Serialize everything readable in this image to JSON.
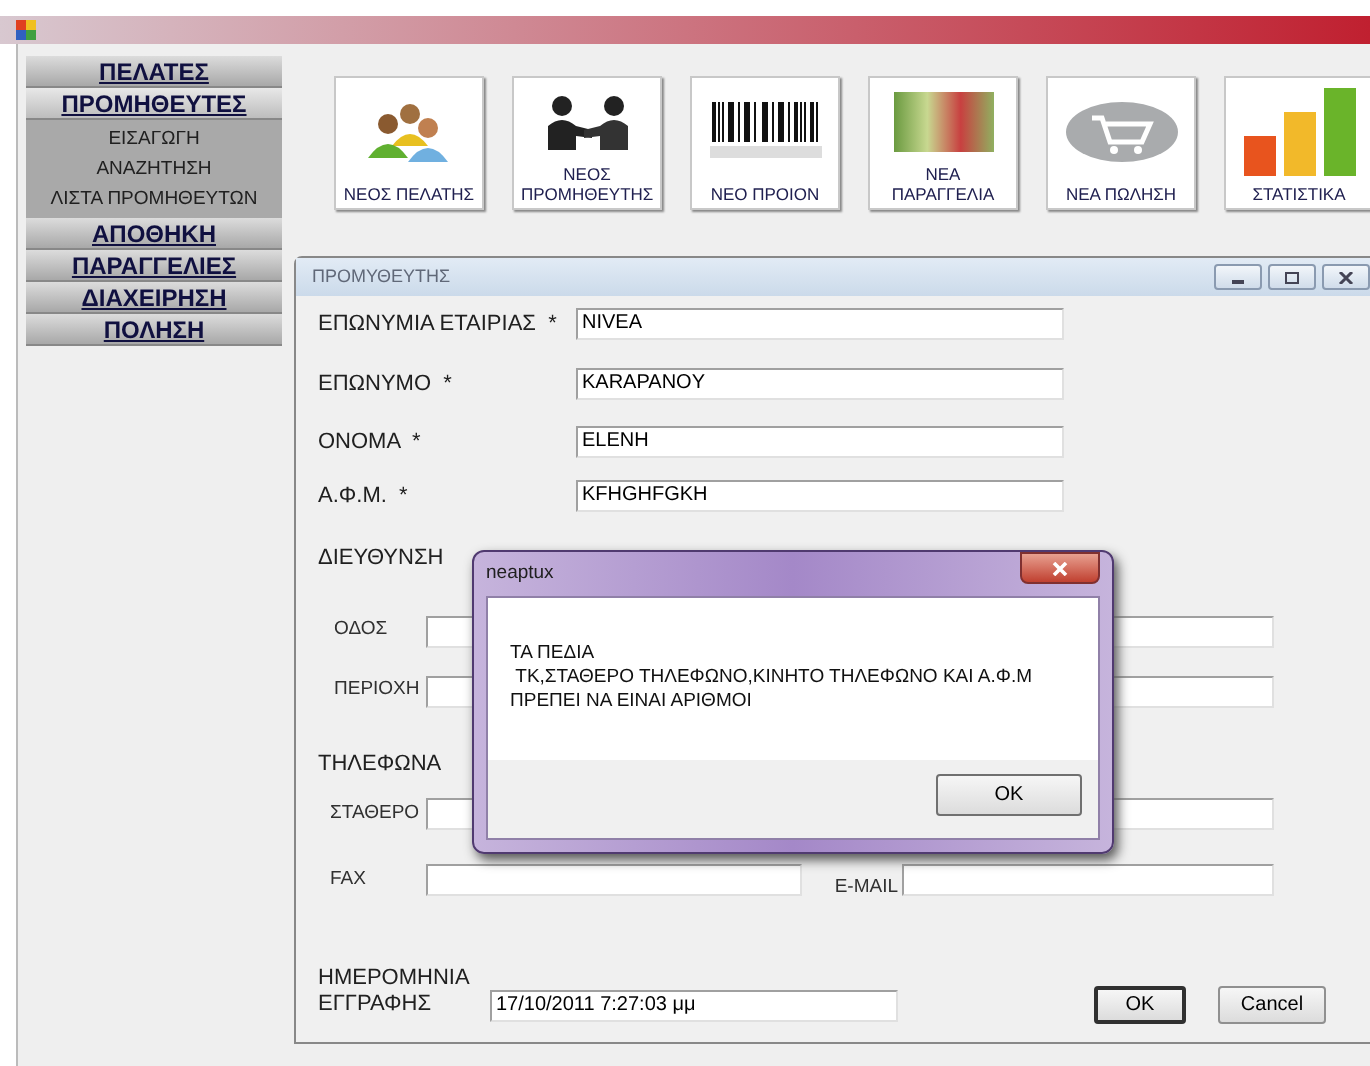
{
  "menu": [
    {
      "label": "ΠΕΛΑΤΕΣ",
      "expanded": false
    },
    {
      "label": "ΠΡΟΜΗΘΕΥΤΕΣ",
      "expanded": true,
      "children": [
        {
          "label": "ΕΙΣΑΓΩΓΗ"
        },
        {
          "label": "ΑΝΑΖΗΤΗΣΗ"
        },
        {
          "label": "ΛΙΣΤΑ ΠΡΟΜΗΘΕΥΤΩΝ"
        }
      ]
    },
    {
      "label": "ΑΠΟΘΗΚΗ",
      "expanded": false
    },
    {
      "label": "ΠΑΡΑΓΓΕΛΙΕΣ",
      "expanded": false
    },
    {
      "label": "ΔΙΑΧΕΙΡΗΣΗ",
      "expanded": false
    },
    {
      "label": "ΠΟΛΗΣΗ",
      "expanded": false
    }
  ],
  "toolbar": [
    {
      "label": "ΝΕΟΣ ΠΕΛΑΤΗΣ",
      "kind": "people"
    },
    {
      "label": "ΝΕΟΣ ΠΡΟΜΗΘΕΥΤΗΣ",
      "kind": "handshake"
    },
    {
      "label": "ΝΕΟ ΠΡΟΙΟΝ",
      "kind": "barcode"
    },
    {
      "label": "ΝΕΑ ΠΑΡΑΓΓΕΛΙΑ",
      "kind": "produce"
    },
    {
      "label": "ΝΕΑ ΠΩΛΗΣΗ",
      "kind": "cart"
    },
    {
      "label": "ΣΤΑΤΙΣΤΙΚΑ",
      "kind": "chart"
    }
  ],
  "form": {
    "title": "ΠΡΟΜΥΘΕΥΤΗΣ",
    "required_fields": [
      {
        "label": "ΕΠΩΝΥΜΙΑ ΕΤΑΙΡΙΑΣ  *",
        "value": "NIVEA"
      },
      {
        "label": "ΕΠΩΝΥΜΟ  *",
        "value": "KARAPANOY"
      },
      {
        "label": "ΟΝΟΜΑ  *",
        "value": "ELENH"
      },
      {
        "label": "Α.Φ.Μ.  *",
        "value": "KFHGHFGKH"
      }
    ],
    "address": {
      "heading": "ΔΙΕΥΘΥΝΣΗ",
      "rows": [
        {
          "label": "ΟΔΟΣ"
        },
        {
          "label": "ΠΕΡΙΟΧΗ"
        }
      ]
    },
    "phones": {
      "heading": "ΤΗΛΕΦΩΝΑ",
      "rows": [
        {
          "label": "ΣΤΑΘΕΡΟ"
        },
        {
          "label": "FAX",
          "second_label": "E-MAIL"
        }
      ]
    },
    "date": {
      "label": "ΗΜΕΡΟΜΗΝΙΑ ΕΓΓΡΑΦΗΣ",
      "value": "17/10/2011 7:27:03 μμ"
    },
    "buttons": [
      {
        "label": "OK",
        "default": true
      },
      {
        "label": "Cancel",
        "default": false
      }
    ]
  },
  "dialog": {
    "title": "neaptux",
    "message": "ΤΑ ΠΕΔΙΑ\n ΤΚ,ΣΤΑΘΕΡΟ ΤΗΛΕΦΩΝΟ,ΚΙΝΗΤΟ ΤΗΛΕΦΩΝΟ ΚΑΙ Α.Φ.Μ\nΠΡΕΠΕΙ ΝΑ ΕΙΝΑΙ ΑΡΙΘΜΟΙ",
    "button": "OK"
  }
}
